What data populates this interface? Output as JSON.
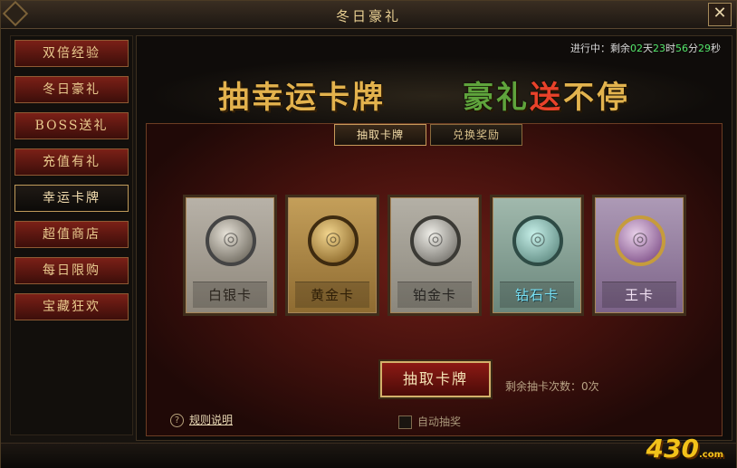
{
  "window": {
    "title": "冬日豪礼",
    "close_symbol": "✕"
  },
  "sidebar": {
    "items": [
      {
        "label": "双倍经验",
        "active": false
      },
      {
        "label": "冬日豪礼",
        "active": false
      },
      {
        "label": "BOSS送礼",
        "active": false
      },
      {
        "label": "充值有礼",
        "active": false
      },
      {
        "label": "幸运卡牌",
        "active": true
      },
      {
        "label": "超值商店",
        "active": false
      },
      {
        "label": "每日限购",
        "active": false
      },
      {
        "label": "宝藏狂欢",
        "active": false
      }
    ]
  },
  "timer": {
    "prefix": "进行中：剩余",
    "days": "02",
    "days_unit": "天",
    "hours": "23",
    "hours_unit": "时",
    "minutes": "56",
    "minutes_unit": "分",
    "seconds": "29",
    "seconds_unit": "秒"
  },
  "banner": {
    "left": "抽幸运卡牌",
    "right_part1": "豪礼",
    "right_part2": "送",
    "right_part3": "不停"
  },
  "tabs": [
    {
      "label": "抽取卡牌",
      "active": true
    },
    {
      "label": "兑换奖励",
      "active": false
    }
  ],
  "cards": [
    {
      "label": "白银卡",
      "icon": "silver-medal"
    },
    {
      "label": "黄金卡",
      "icon": "gold-medal"
    },
    {
      "label": "铂金卡",
      "icon": "platinum-medal"
    },
    {
      "label": "钻石卡",
      "icon": "diamond-medal"
    },
    {
      "label": "王卡",
      "icon": "king-medal"
    }
  ],
  "draw_button": {
    "label": "抽取卡牌"
  },
  "remaining": {
    "text": "剩余抽卡次数：0次"
  },
  "rules": {
    "icon": "?",
    "label": "规则说明"
  },
  "auto_draw": {
    "label": "自动抽奖",
    "checked": false
  },
  "logo": {
    "text": "430",
    "suffix": ".com"
  },
  "colors": {
    "accent_gold": "#e3b24d",
    "timer_green": "#53e66b",
    "banner_red": "#e8422a",
    "banner_green": "#5fa33c"
  }
}
